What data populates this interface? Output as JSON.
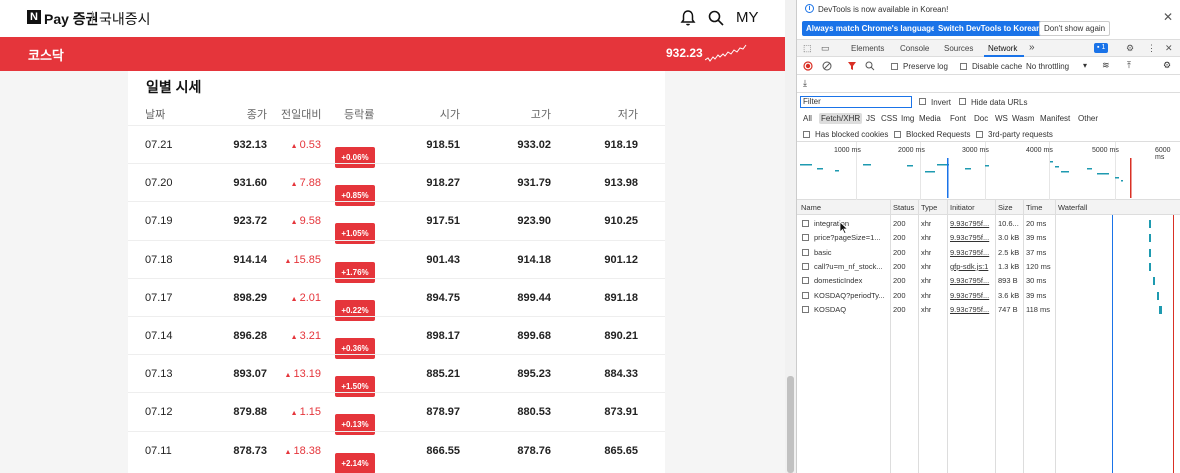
{
  "header": {
    "logo_n": "N",
    "logo_pay": "Pay 증권",
    "logo_section": "국내증시",
    "my": "MY",
    "bell_icon": "bell-icon",
    "search_icon": "search-icon"
  },
  "index_bar": {
    "title": "코스닥",
    "value": "932.23"
  },
  "daily": {
    "title": "일별 시세",
    "columns": [
      "날짜",
      "종가",
      "전일대비",
      "등락률",
      "시가",
      "고가",
      "저가"
    ],
    "rows": [
      {
        "date": "07.21",
        "close": "932.13",
        "change": "0.53",
        "pct": "+0.06%",
        "open": "918.51",
        "high": "933.02",
        "low": "918.19"
      },
      {
        "date": "07.20",
        "close": "931.60",
        "change": "7.88",
        "pct": "+0.85%",
        "open": "918.27",
        "high": "931.79",
        "low": "913.98"
      },
      {
        "date": "07.19",
        "close": "923.72",
        "change": "9.58",
        "pct": "+1.05%",
        "open": "917.51",
        "high": "923.90",
        "low": "910.25"
      },
      {
        "date": "07.18",
        "close": "914.14",
        "change": "15.85",
        "pct": "+1.76%",
        "open": "901.43",
        "high": "914.18",
        "low": "901.12"
      },
      {
        "date": "07.17",
        "close": "898.29",
        "change": "2.01",
        "pct": "+0.22%",
        "open": "894.75",
        "high": "899.44",
        "low": "891.18"
      },
      {
        "date": "07.14",
        "close": "896.28",
        "change": "3.21",
        "pct": "+0.36%",
        "open": "898.17",
        "high": "899.68",
        "low": "890.21"
      },
      {
        "date": "07.13",
        "close": "893.07",
        "change": "13.19",
        "pct": "+1.50%",
        "open": "885.21",
        "high": "895.23",
        "low": "884.33"
      },
      {
        "date": "07.12",
        "close": "879.88",
        "change": "1.15",
        "pct": "+0.13%",
        "open": "878.97",
        "high": "880.53",
        "low": "873.91"
      },
      {
        "date": "07.11",
        "close": "878.73",
        "change": "18.38",
        "pct": "+2.14%",
        "open": "866.55",
        "high": "878.76",
        "low": "865.65"
      }
    ]
  },
  "devtools": {
    "info_text": "DevTools is now available in Korean!",
    "btn_match": "Always match Chrome's language",
    "btn_switch": "Switch DevTools to Korean",
    "btn_dont": "Don't show again",
    "tabs": [
      "Elements",
      "Console",
      "Sources",
      "Network"
    ],
    "tab_more": "»",
    "badge": "1",
    "preserve_log": "Preserve log",
    "disable_cache": "Disable cache",
    "throttling": "No throttling",
    "filter_placeholder": "Filter",
    "invert": "Invert",
    "hide_data_urls": "Hide data URLs",
    "types": [
      "All",
      "Fetch/XHR",
      "JS",
      "CSS",
      "Img",
      "Media",
      "Font",
      "Doc",
      "WS",
      "Wasm",
      "Manifest",
      "Other"
    ],
    "has_blocked_cookies": "Has blocked cookies",
    "blocked_requests": "Blocked Requests",
    "third_party": "3rd-party requests",
    "timeline_labels": [
      "1000 ms",
      "2000 ms",
      "3000 ms",
      "4000 ms",
      "5000 ms",
      "6000 ms"
    ],
    "columns": [
      "Name",
      "Status",
      "Type",
      "Initiator",
      "Size",
      "Time",
      "Waterfall"
    ],
    "requests": [
      {
        "name": "integration",
        "status": "200",
        "type": "xhr",
        "initiator": "9.93c795f...",
        "size": "10.6...",
        "time": "20 ms"
      },
      {
        "name": "price?pageSize=1...",
        "status": "200",
        "type": "xhr",
        "initiator": "9.93c795f...",
        "size": "3.0 kB",
        "time": "39 ms"
      },
      {
        "name": "basic",
        "status": "200",
        "type": "xhr",
        "initiator": "9.93c795f...",
        "size": "2.5 kB",
        "time": "37 ms"
      },
      {
        "name": "call?u=m_nf_stock...",
        "status": "200",
        "type": "xhr",
        "initiator": "gfp-sdk.js:1",
        "size": "1.3 kB",
        "time": "120 ms"
      },
      {
        "name": "domesticIndex",
        "status": "200",
        "type": "xhr",
        "initiator": "9.93c795f...",
        "size": "893 B",
        "time": "30 ms"
      },
      {
        "name": "KOSDAQ?periodTy...",
        "status": "200",
        "type": "xhr",
        "initiator": "9.93c795f...",
        "size": "3.6 kB",
        "time": "39 ms"
      },
      {
        "name": "KOSDAQ",
        "status": "200",
        "type": "xhr",
        "initiator": "9.93c795f...",
        "size": "747 B",
        "time": "118 ms"
      }
    ]
  },
  "colors": {
    "accent_red": "#e5353b",
    "devtools_blue": "#1a73e8"
  }
}
